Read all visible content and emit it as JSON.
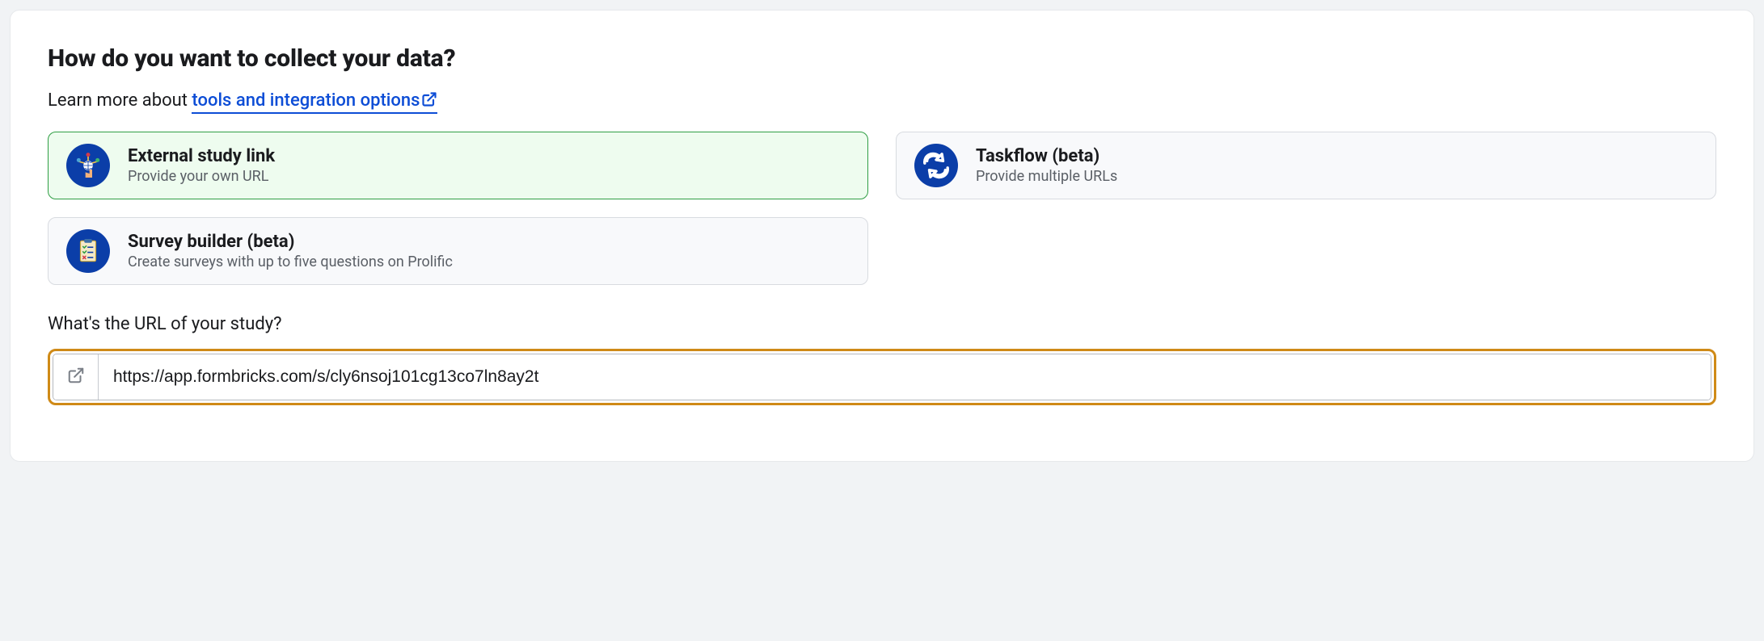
{
  "heading": "How do you want to collect your data?",
  "learn_more": {
    "prefix": "Learn more about ",
    "link_text": "tools and integration options"
  },
  "options": {
    "external": {
      "title": "External study link",
      "desc": "Provide your own URL"
    },
    "taskflow": {
      "title": "Taskflow (beta)",
      "desc": "Provide multiple URLs"
    },
    "survey": {
      "title": "Survey builder (beta)",
      "desc": "Create surveys with up to five questions on Prolific"
    }
  },
  "url_field": {
    "label": "What's the URL of your study?",
    "value": "https://app.formbricks.com/s/cly6nsoj101cg13co7ln8ay2t"
  }
}
